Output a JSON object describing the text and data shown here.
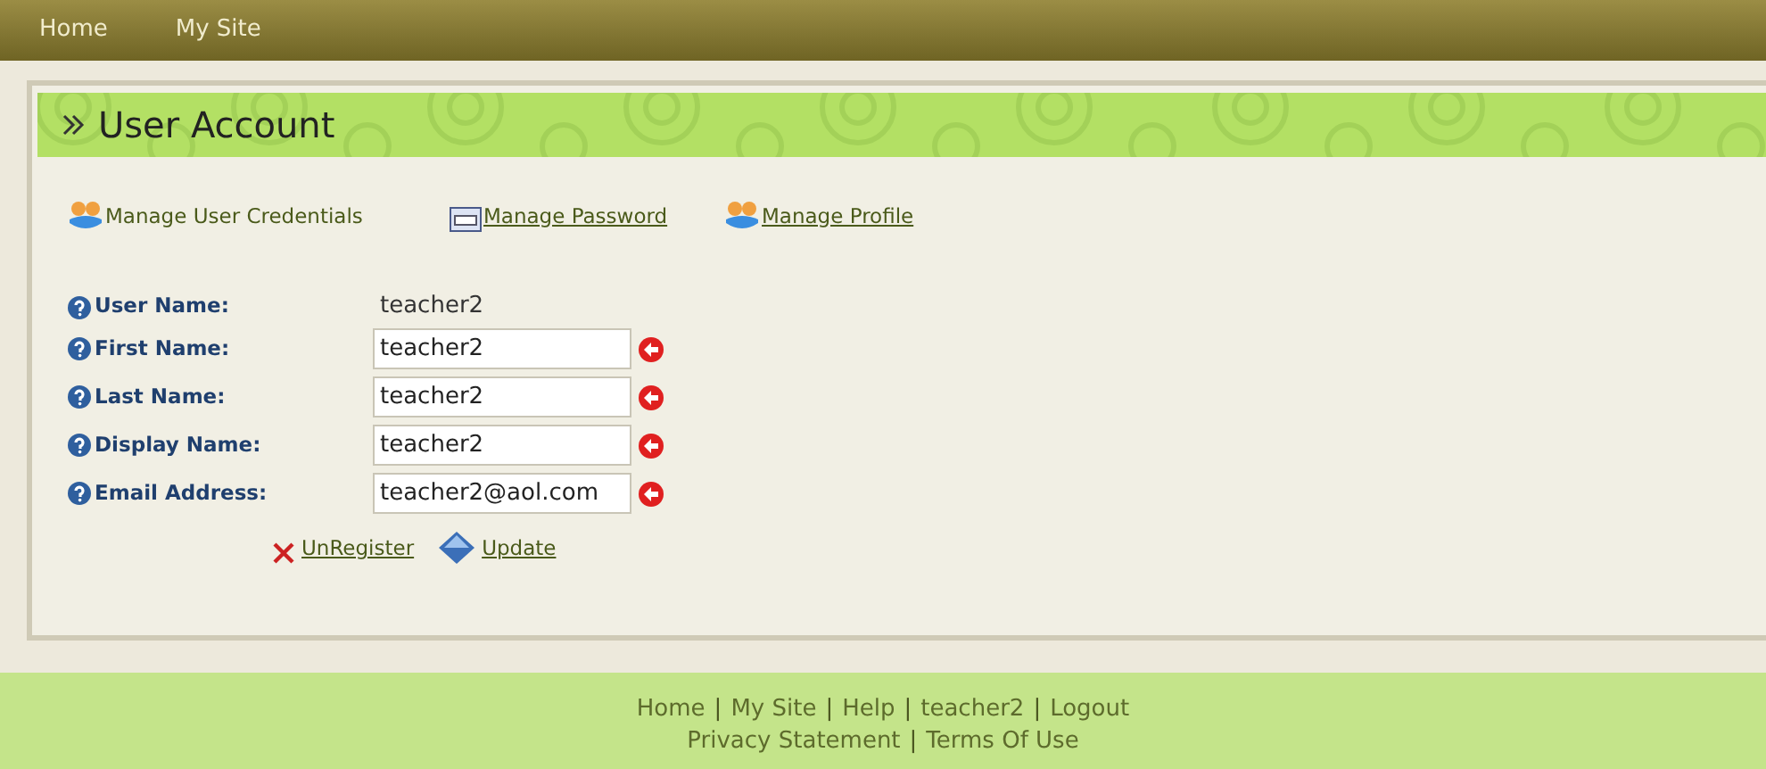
{
  "top_nav": {
    "items": [
      {
        "label": "Home"
      },
      {
        "label": "My Site"
      }
    ]
  },
  "panel": {
    "title": "User Account",
    "links": [
      {
        "label": "Manage User Credentials",
        "kind": "plain"
      },
      {
        "label": "Manage Password",
        "kind": "link"
      },
      {
        "label": "Manage Profile",
        "kind": "link"
      }
    ],
    "fields": [
      {
        "label": "User Name:",
        "kind": "text",
        "value": "teacher2"
      },
      {
        "label": "First Name:",
        "kind": "input",
        "value": "teacher2"
      },
      {
        "label": "Last Name:",
        "kind": "input",
        "value": "teacher2"
      },
      {
        "label": "Display Name:",
        "kind": "input",
        "value": "teacher2"
      },
      {
        "label": "Email Address:",
        "kind": "input",
        "value": "teacher2@aol.com"
      }
    ],
    "actions": [
      {
        "label": "UnRegister"
      },
      {
        "label": "Update"
      }
    ]
  },
  "footer": {
    "separator": "|",
    "lines": [
      {
        "links": [
          {
            "label": "Home"
          },
          {
            "label": "My Site"
          },
          {
            "label": "Help"
          },
          {
            "label": "teacher2"
          },
          {
            "label": "Logout"
          }
        ]
      },
      {
        "links": [
          {
            "label": "Privacy Statement"
          },
          {
            "label": "Terms Of Use"
          }
        ]
      }
    ]
  }
}
